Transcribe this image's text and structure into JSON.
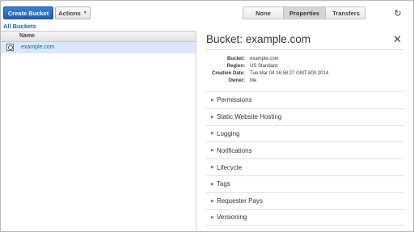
{
  "toolbar": {
    "create_bucket_label": "Create Bucket",
    "actions_label": "Actions",
    "view_tabs": [
      {
        "label": "None",
        "active": false
      },
      {
        "label": "Properties",
        "active": true
      },
      {
        "label": "Transfers",
        "active": false
      }
    ],
    "refresh_icon": "refresh-icon",
    "accent_color": "#1f5fb8"
  },
  "left": {
    "all_buckets_label": "All Buckets",
    "column_header": "Name",
    "buckets": [
      {
        "name": "example.com",
        "selected": true
      }
    ]
  },
  "detail": {
    "title": "Bucket: example.com",
    "close_icon": "close-icon",
    "properties": [
      {
        "label": "Bucket:",
        "value": "example.com"
      },
      {
        "label": "Region:",
        "value": "US Standard"
      },
      {
        "label": "Creation Date:",
        "value": "Tue Mar 04 16:58:27 GMT-800 2014"
      },
      {
        "label": "Owner:",
        "value": "Me"
      }
    ],
    "sections": [
      "Permissions",
      "Static Website Hosting",
      "Logging",
      "Notifications",
      "Lifecycle",
      "Tags",
      "Requester Pays",
      "Versioning"
    ]
  }
}
